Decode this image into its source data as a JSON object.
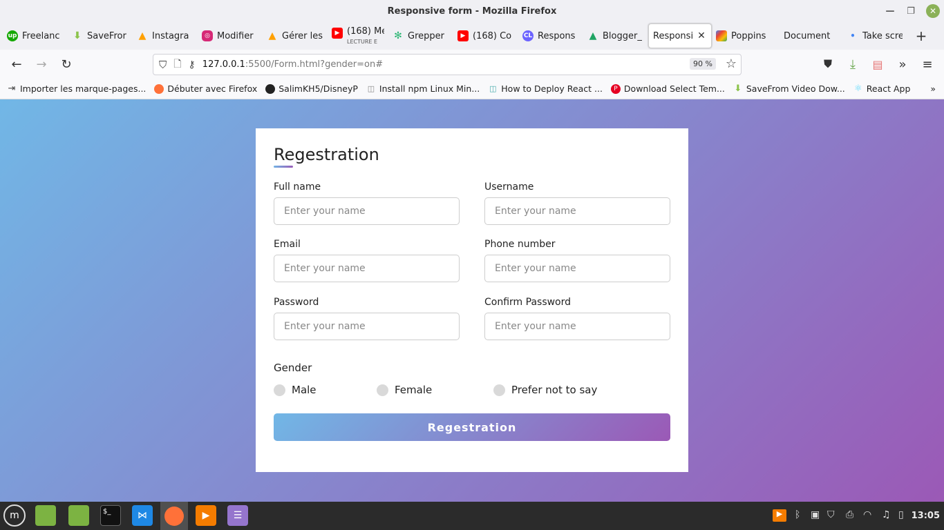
{
  "window": {
    "title": "Responsive form - Mozilla Firefox"
  },
  "tabs": [
    {
      "label": "Freelanc",
      "icon": "upwork-icon",
      "color": "#14a800"
    },
    {
      "label": "SaveFror",
      "icon": "download-arrow-icon",
      "color": "#8bc34a"
    },
    {
      "label": "Instagra",
      "icon": "firebase-icon",
      "color": "#ffa000"
    },
    {
      "label": "Modifier",
      "icon": "instagram-icon",
      "color": "#d62976"
    },
    {
      "label": "Gérer les",
      "icon": "firebase-icon",
      "color": "#ffa000"
    },
    {
      "label": "(168) Me",
      "sub": "LECTURE E",
      "icon": "youtube-icon",
      "color": "#ff0000"
    },
    {
      "label": "Grepper",
      "icon": "grepper-icon",
      "color": "#2bb673"
    },
    {
      "label": "(168) Co",
      "icon": "youtube-icon",
      "color": "#ff0000"
    },
    {
      "label": "Respons",
      "icon": "codinglab-icon",
      "color": "#6c63ff"
    },
    {
      "label": "Blogger_",
      "icon": "google-drive-icon",
      "color": "#1fa463"
    },
    {
      "label": "Responsi",
      "icon": "none",
      "color": "#fff",
      "active": true
    },
    {
      "label": "Poppins",
      "icon": "google-fonts-icon",
      "color": "#4285f4"
    },
    {
      "label": "Document",
      "icon": "none",
      "color": "#fff"
    },
    {
      "label": "Take scre",
      "icon": "dot-icon",
      "color": "#4285f4"
    }
  ],
  "url": {
    "host": "127.0.0.1",
    "rest": ":5500/Form.html?gender=on#",
    "zoom": "90 %"
  },
  "bookmarks": [
    {
      "label": "Importer les marque-pages...",
      "icon": "import-icon",
      "color": "#444"
    },
    {
      "label": "Débuter avec Firefox",
      "icon": "firefox-icon",
      "color": "#ff7139"
    },
    {
      "label": "SalimKH5/DisneyP",
      "icon": "github-icon",
      "color": "#222"
    },
    {
      "label": "Install npm Linux Min...",
      "icon": "page-icon",
      "color": "#888"
    },
    {
      "label": "How to Deploy React ...",
      "icon": "page-icon",
      "color": "#4aa"
    },
    {
      "label": "Download Select Tem...",
      "icon": "pinterest-icon",
      "color": "#e60023"
    },
    {
      "label": "SaveFrom Video Dow...",
      "icon": "download-arrow-icon",
      "color": "#8bc34a"
    },
    {
      "label": "React App",
      "icon": "react-icon",
      "color": "#61dafb"
    }
  ],
  "form": {
    "title": "Regestration",
    "fields": [
      {
        "label": "Full name",
        "placeholder": "Enter your name"
      },
      {
        "label": "Username",
        "placeholder": "Enter your name"
      },
      {
        "label": "Email",
        "placeholder": "Enter your name"
      },
      {
        "label": "Phone number",
        "placeholder": "Enter your name"
      },
      {
        "label": "Password",
        "placeholder": "Enter your name"
      },
      {
        "label": "Confirm Password",
        "placeholder": "Enter your name"
      }
    ],
    "gender_title": "Gender",
    "gender_options": [
      "Male",
      "Female",
      "Prefer not to say"
    ],
    "submit_label": "Regestration"
  },
  "taskbar": {
    "clock": "13:05"
  }
}
